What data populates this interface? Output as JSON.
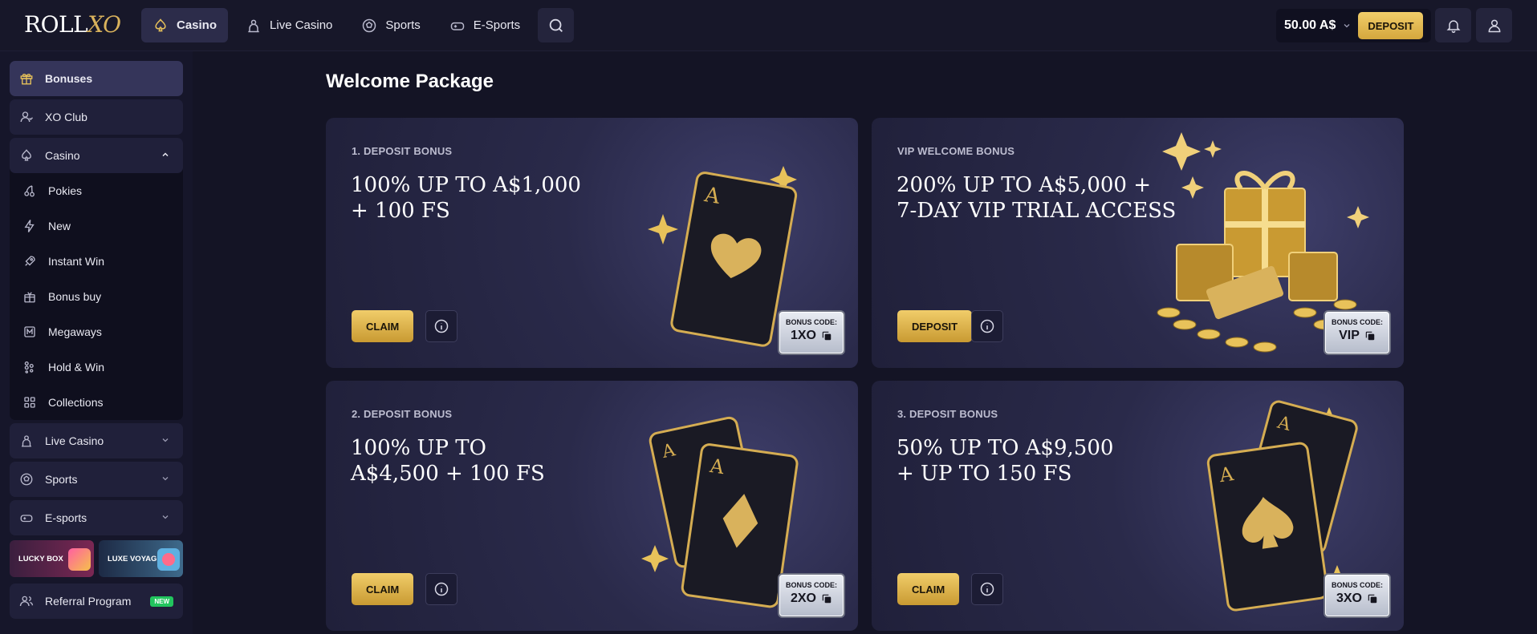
{
  "brand": {
    "logo_main": "ROLL",
    "logo_accent": "XO"
  },
  "topnav": [
    {
      "label": "Casino",
      "icon": "spade-icon",
      "active": true
    },
    {
      "label": "Live Casino",
      "icon": "dealer-icon",
      "active": false
    },
    {
      "label": "Sports",
      "icon": "soccer-ball-icon",
      "active": false
    },
    {
      "label": "E-Sports",
      "icon": "gamepad-icon",
      "active": false
    }
  ],
  "header": {
    "balance": "50.00 A$",
    "deposit_label": "DEPOSIT"
  },
  "sidebar": {
    "items": [
      {
        "label": "Bonuses",
        "icon": "gift-icon"
      },
      {
        "label": "XO Club",
        "icon": "club-icon"
      },
      {
        "label": "Casino",
        "icon": "spade-icon"
      }
    ],
    "casino_sub": [
      {
        "label": "Pokies",
        "icon": "cherries-icon"
      },
      {
        "label": "New",
        "icon": "lightning-icon"
      },
      {
        "label": "Instant Win",
        "icon": "rocket-icon"
      },
      {
        "label": "Bonus buy",
        "icon": "gift-box-icon"
      },
      {
        "label": "Megaways",
        "icon": "megaways-icon"
      },
      {
        "label": "Hold & Win",
        "icon": "hold-win-icon"
      },
      {
        "label": "Collections",
        "icon": "grid-icon"
      }
    ],
    "collapsed": [
      {
        "label": "Live Casino",
        "icon": "dealer-icon"
      },
      {
        "label": "Sports",
        "icon": "soccer-ball-icon"
      },
      {
        "label": "E-sports",
        "icon": "gamepad-icon"
      }
    ],
    "promos": [
      {
        "label": "LUCKY BOX"
      },
      {
        "label": "LUXE VOYAGE"
      }
    ],
    "referral": {
      "label": "Referral Program",
      "badge": "NEW"
    }
  },
  "main": {
    "title": "Welcome Package",
    "cards": [
      {
        "kicker": "1. DEPOSIT BONUS",
        "headline_1": "100% UP TO A$1,000",
        "headline_2": "+ 100 FS",
        "button": "CLAIM",
        "code_label": "BONUS CODE:",
        "code": "1XO"
      },
      {
        "kicker": "VIP WELCOME BONUS",
        "headline_1": "200% UP TO A$5,000 +",
        "headline_2": "7-DAY VIP TRIAL ACCESS",
        "button": "DEPOSIT",
        "code_label": "BONUS CODE:",
        "code": "VIP"
      },
      {
        "kicker": "2. DEPOSIT BONUS",
        "headline_1": "100% UP TO",
        "headline_2": "A$4,500 + 100 FS",
        "button": "CLAIM",
        "code_label": "BONUS CODE:",
        "code": "2XO"
      },
      {
        "kicker": "3. DEPOSIT BONUS",
        "headline_1": "50% UP TO A$9,500",
        "headline_2": "+ UP TO 150 FS",
        "button": "CLAIM",
        "code_label": "BONUS CODE:",
        "code": "3XO"
      }
    ]
  },
  "colors": {
    "accent_gold": "#e8c25a",
    "bg": "#141425",
    "card": "#2a2a4a",
    "new_badge": "#22c55e"
  }
}
